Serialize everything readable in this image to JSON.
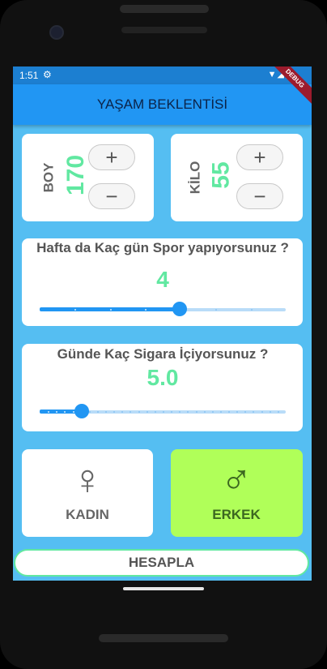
{
  "status": {
    "time": "1:51",
    "gear": "⚙",
    "icons": "▼◢▮"
  },
  "debug_banner": "DEBUG",
  "appbar": {
    "title": "YAŞAM BEKLENTİSİ"
  },
  "boy": {
    "label": "BOY",
    "value": "170",
    "plus": "+",
    "minus": "−"
  },
  "kilo": {
    "label": "KİLO",
    "value": "55",
    "plus": "+",
    "minus": "−"
  },
  "spor": {
    "question": "Hafta da Kaç gün Spor yapıyorsunuz ?",
    "value": "4",
    "slider_fraction": 0.57,
    "divisions": 7
  },
  "sigara": {
    "question": "Günde Kaç Sigara İçiyorsunuz ?",
    "value": "5.0",
    "slider_fraction": 0.17,
    "divisions": 30
  },
  "gender": {
    "female": {
      "label": "KADIN",
      "icon": "♀",
      "icon_name": "female-icon"
    },
    "male": {
      "label": "ERKEK",
      "icon": "♂",
      "icon_name": "male-icon",
      "selected": true
    }
  },
  "hesapla_label": "HESAPLA",
  "colors": {
    "accent": "#2196f3",
    "value_green": "#61e8a1",
    "selected_card": "#b0ff59",
    "background": "#55bef2"
  }
}
